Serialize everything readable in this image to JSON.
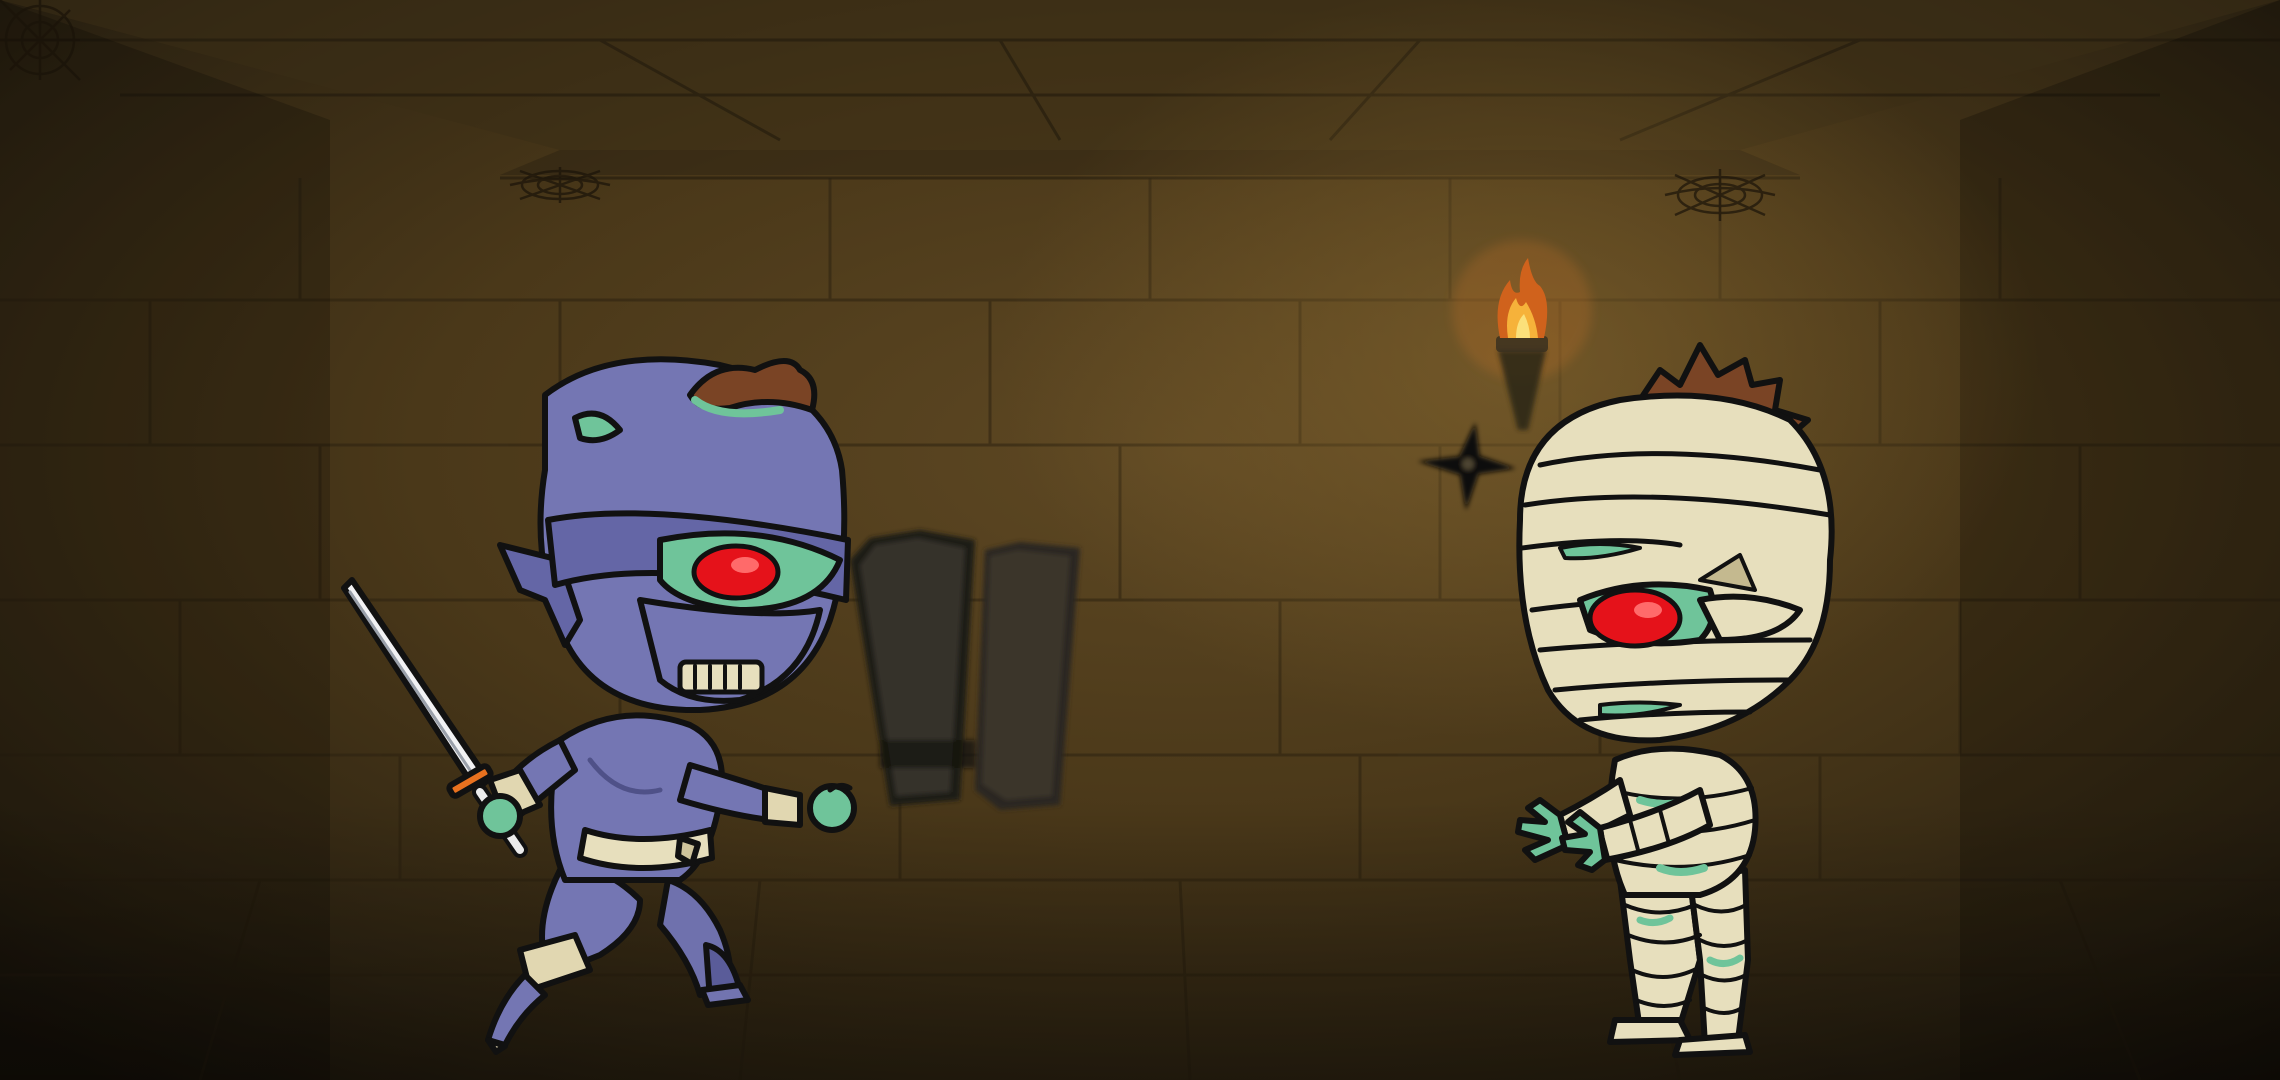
{
  "scene": {
    "setting": "tomb-corridor",
    "colors": {
      "wall": "#5a4420",
      "wall_dark": "#1e170d",
      "ninja_suit": "#7476b3",
      "ninja_suit_dark": "#4f5188",
      "mummy_wrap": "#e7dfbd",
      "mummy_wrap_shade": "#c4b98f",
      "zombie_skin": "#6fc49a",
      "eye_red": "#e5121a",
      "hair": "#7a4425",
      "torch_flame": "#f29a1e"
    },
    "objects": {
      "background": "tomb-wall",
      "torch": "wall-torch",
      "shuriken": "throwing-star",
      "coffins": "coffin-pair",
      "webs": "cobweb"
    },
    "player": {
      "character": "zombie-ninja",
      "weapon": "katana"
    },
    "enemy": {
      "character": "mummy"
    }
  }
}
